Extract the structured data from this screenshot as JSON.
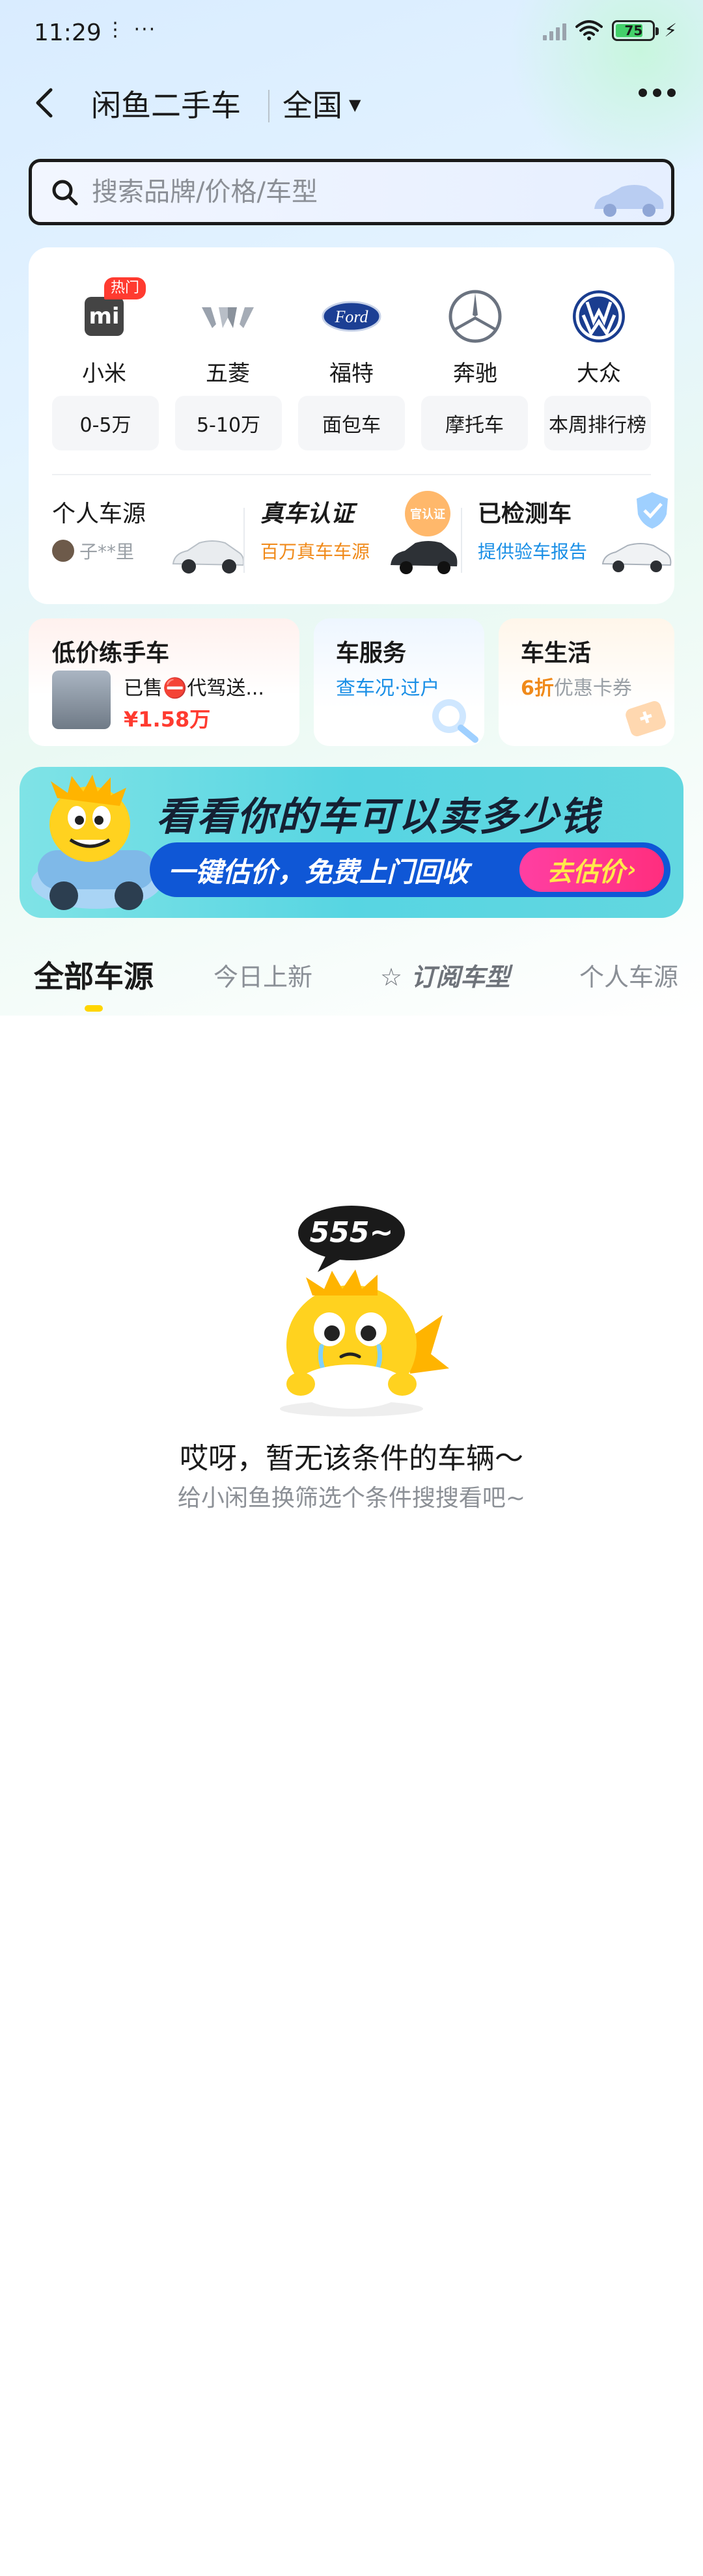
{
  "status_bar": {
    "time": "11:29",
    "dots": "⋮ ···",
    "battery_level": "75"
  },
  "header": {
    "title": "闲鱼二手车",
    "region": "全国"
  },
  "search": {
    "placeholder": "搜索品牌/价格/车型"
  },
  "brands": [
    {
      "name": "小米",
      "badge": "热门",
      "icon": "xiaomi-logo"
    },
    {
      "name": "五菱",
      "icon": "wuling-logo"
    },
    {
      "name": "福特",
      "icon": "ford-logo",
      "logo_text": "Ford"
    },
    {
      "name": "奔驰",
      "icon": "mercedes-logo"
    },
    {
      "name": "大众",
      "icon": "volkswagen-logo"
    }
  ],
  "chips": [
    "0-5万",
    "5-10万",
    "面包车",
    "摩托车",
    "本周排行榜"
  ],
  "features": {
    "personal": {
      "title": "个人车源",
      "sub": "子**里"
    },
    "verified": {
      "title": "真车认证",
      "sub": "百万真车车源",
      "badge": "官认证"
    },
    "inspected": {
      "title": "已检测车",
      "sub": "提供验车报告"
    }
  },
  "services": {
    "cheap": {
      "title": "低价练手车",
      "desc": "已售⛔代驾送...",
      "price": "¥1.58万"
    },
    "car_service": {
      "title": "车服务",
      "sub": "查车况·过户"
    },
    "car_life": {
      "title": "车生活",
      "discount": "6折",
      "sub": "优惠卡券"
    }
  },
  "banner": {
    "headline": "看看你的车可以卖多少钱",
    "pill": "一键估价，免费上门回收",
    "cta": "去估价"
  },
  "tabs": [
    "全部车源",
    "今日上新",
    "订阅车型",
    "个人车源"
  ],
  "empty_state": {
    "bubble": "555~",
    "title": "哎呀，暂无该条件的车辆～",
    "subtitle": "给小闲鱼换筛选个条件搜搜看吧~"
  },
  "colors": {
    "accent_yellow": "#ffd500",
    "orange": "#f08a1a",
    "blue": "#1a8fe6",
    "red_price": "#ff3b30"
  }
}
